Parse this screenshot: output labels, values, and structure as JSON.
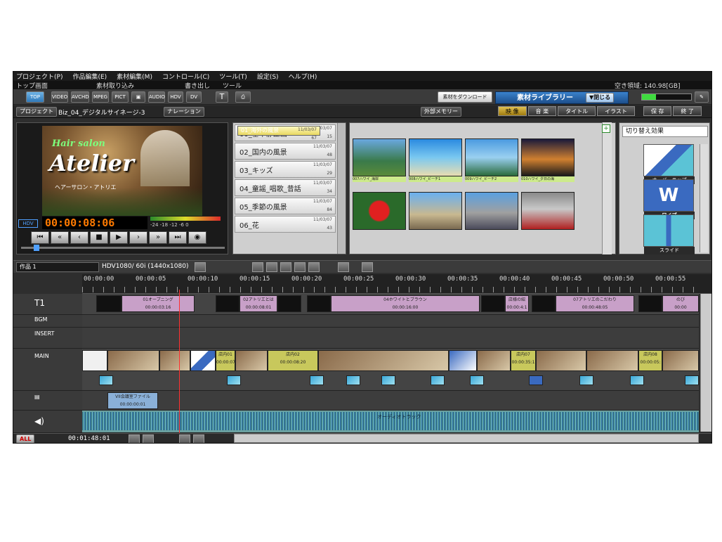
{
  "menu": [
    "プロジェクト(P)",
    "作品編集(E)",
    "素材編集(M)",
    "コントロール(C)",
    "ツール(T)",
    "設定(S)",
    "ヘルプ(H)"
  ],
  "tabs": [
    "トップ画面",
    "素材取り込み",
    "書き出し",
    "ツール"
  ],
  "disk_free": "空き領域: 140.98[GB]",
  "toolbar": {
    "top": "TOP",
    "video": "VIDEO",
    "avchd": "AVCHD",
    "mpeg": "MPEG",
    "pict": "PICT",
    "audio": "AUDIO",
    "hdv": "HDV",
    "t": "T",
    "download": "素材をダウンロード"
  },
  "project": {
    "label": "プロジェクト",
    "name": "Biz_04_デジタルサイネージ-3",
    "narration": "ナレーション",
    "external": "外部メモリー"
  },
  "library": {
    "title": "素材ライブラリー",
    "close": "▼閉じる",
    "tabs": [
      "映 像",
      "音 楽",
      "タイトル",
      "イラスト"
    ],
    "save": "保 存",
    "exit": "終 了"
  },
  "preview": {
    "subtitle": "Hair salon",
    "title": "Atelier",
    "caption": "ヘアーサロン・アトリエ",
    "timecode": "00:00:08:06",
    "hdv": "HDV",
    "vu": "-24  -18  -12  -6  0"
  },
  "folders": [
    {
      "name": "00_基本静止画",
      "date": "11/03/07",
      "count": "15"
    },
    {
      "name": "01_海外の風景",
      "date": "11/03/07",
      "count": "67"
    },
    {
      "name": "02_国内の風景",
      "date": "11/03/07",
      "count": "48"
    },
    {
      "name": "03_キッズ",
      "date": "11/03/07",
      "count": "29"
    },
    {
      "name": "04_童謡_唱歌_昔話",
      "date": "11/03/07",
      "count": "34"
    },
    {
      "name": "05_季節の風景",
      "date": "11/03/07",
      "count": "84"
    },
    {
      "name": "06_花",
      "date": "11/03/07",
      "count": "43"
    }
  ],
  "thumbs": [
    {
      "cap": "007ハワイ_海岸"
    },
    {
      "cap": "008ハワイ_ビーチ1"
    },
    {
      "cap": "009ハワイ_ビーチ2"
    },
    {
      "cap": "010ハワイ_夕日の海"
    },
    {
      "cap": ""
    },
    {
      "cap": ""
    },
    {
      "cap": ""
    },
    {
      "cap": ""
    }
  ],
  "effects": {
    "category": "切り替え効果",
    "items": [
      "オーバーラップ",
      "ワイプ",
      "スライド"
    ]
  },
  "timeline": {
    "sequence": "作品 1",
    "format": "HDV1080/ 60i (1440x1080)",
    "ticks": [
      "00:00:00",
      "00:00:05",
      "00:00:10",
      "00:00:15",
      "00:00:20",
      "00:00:25",
      "00:00:30",
      "00:00:35",
      "00:00:40",
      "00:00:45",
      "00:00:50",
      "00:00:55"
    ],
    "tracks": {
      "t1": "T1",
      "bgm": "BGM",
      "insert": "INSERT",
      "main": "MAIN"
    },
    "title_clips": [
      {
        "label": "01オープニング",
        "tc": "00:00:03:16"
      },
      {
        "label": "02アトリエとは",
        "tc": "00:00:08:01"
      },
      {
        "label": "04ホワイトとブラウン",
        "tc": "00:00:16:00"
      },
      {
        "label": "店様の紹",
        "tc": "00:00:4:1"
      },
      {
        "label": "07アトリエのこだわり",
        "tc": "00:00:48:05"
      },
      {
        "label": "のび",
        "tc": "00:00"
      }
    ],
    "main_clips": [
      {
        "label": "店内01",
        "tc": "00:00:07:"
      },
      {
        "label": "店内02",
        "tc": "00:00:08:20"
      },
      {
        "label": "店内07",
        "tc": "00:00:35:1"
      },
      {
        "label": "店内08",
        "tc": "00:00:05:"
      }
    ],
    "sub_clip": {
      "label": "VII会議室ファイル",
      "tc": "00:00:00:01"
    },
    "audio_label": "オーディオトラック",
    "total": "00:01:48:01",
    "all": "ALL"
  }
}
